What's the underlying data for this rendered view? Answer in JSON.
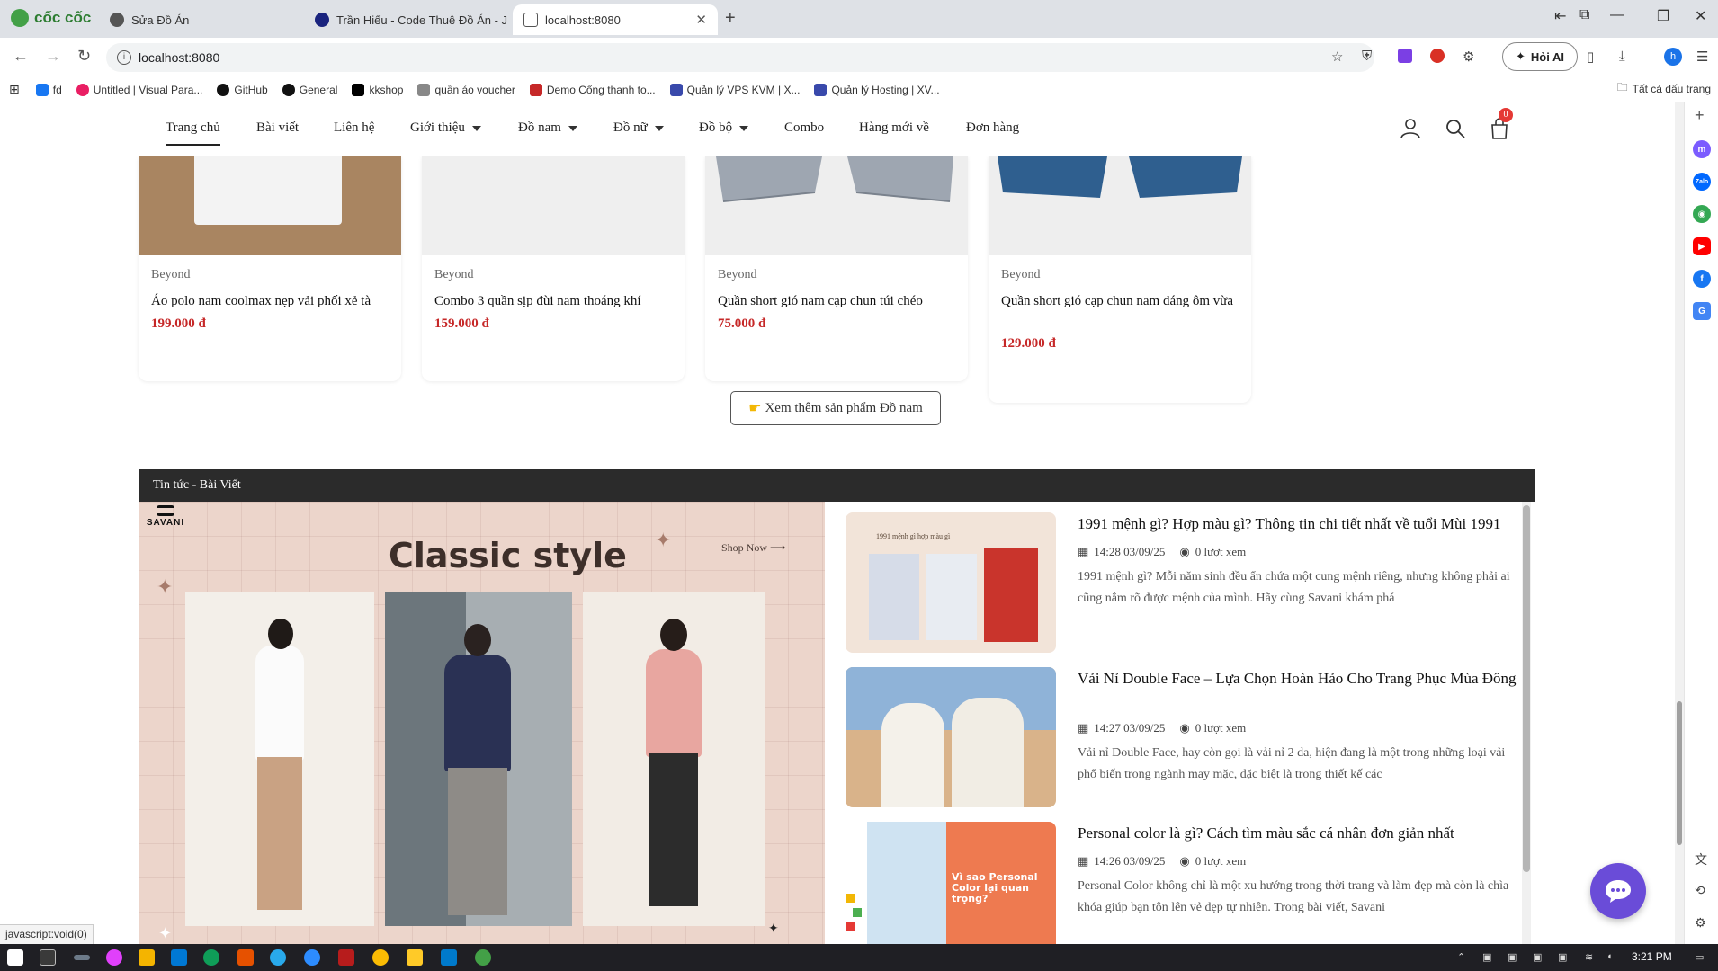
{
  "browser": {
    "brand": "cốc cốc",
    "tabs": [
      {
        "title": "Sửa Đồ Án",
        "active": false
      },
      {
        "title": "Trần Hiếu - Code Thuê Đồ Án - J",
        "active": false
      },
      {
        "title": "localhost:8080",
        "active": true
      }
    ],
    "address": "localhost:8080",
    "ai_button": "Hỏi AI",
    "profile_initial": "h",
    "bookmarks": [
      "fd",
      "Untitled | Visual Para...",
      "GitHub",
      "General",
      "kkshop",
      "quần áo voucher",
      "Demo Cổng thanh to...",
      "Quản lý VPS KVM | X...",
      "Quản lý Hosting | XV..."
    ],
    "all_bookmarks": "Tất cả dấu trang",
    "status_url": "javascript:void(0)"
  },
  "nav": {
    "items": [
      {
        "label": "Trang chủ",
        "dropdown": false,
        "active": true
      },
      {
        "label": "Bài viết",
        "dropdown": false,
        "active": false
      },
      {
        "label": "Liên hệ",
        "dropdown": false,
        "active": false
      },
      {
        "label": "Giới thiệu",
        "dropdown": true,
        "active": false
      },
      {
        "label": "Đồ nam",
        "dropdown": true,
        "active": false
      },
      {
        "label": "Đồ nữ",
        "dropdown": true,
        "active": false
      },
      {
        "label": "Đồ bộ",
        "dropdown": true,
        "active": false
      },
      {
        "label": "Combo",
        "dropdown": false,
        "active": false
      },
      {
        "label": "Hàng mới về",
        "dropdown": false,
        "active": false
      },
      {
        "label": "Đơn hàng",
        "dropdown": false,
        "active": false
      }
    ],
    "cart_count": "0",
    "icons": [
      "user-icon",
      "search-icon",
      "cart-icon"
    ]
  },
  "products": [
    {
      "brand": "Beyond",
      "name": "Áo polo nam coolmax nẹp vải phối xẻ tà",
      "price": "199.000 đ"
    },
    {
      "brand": "Beyond",
      "name": "Combo 3 quần sịp đùi nam thoáng khí",
      "price": "159.000 đ"
    },
    {
      "brand": "Beyond",
      "name": "Quần short gió nam cạp chun túi chéo",
      "price": "75.000 đ"
    },
    {
      "brand": "Beyond",
      "name": "Quần short gió cạp chun nam dáng ôm vừa",
      "price": "129.000 đ"
    }
  ],
  "see_more": "Xem thêm sản phẩm Đồ nam",
  "news": {
    "header": "Tin tức - Bài Viết",
    "banner": {
      "logo": "SAVANI",
      "title": "Classic style",
      "shop_now": "Shop Now"
    },
    "items": [
      {
        "title": "1991 mệnh gì? Hợp màu gì? Thông tin chi tiết nhất về tuổi Mùi 1991",
        "time": "14:28 03/09/25",
        "views": "0 lượt xem",
        "excerpt": "1991 mệnh gì? Mỗi năm sinh đều ẩn chứa một cung mệnh riêng, nhưng không phải ai cũng nắm rõ được mệnh của mình. Hãy cùng Savani khám phá",
        "thumb_caption": "1991 mệnh gì hợp màu gì"
      },
      {
        "title": "Vải Nỉ Double Face – Lựa Chọn Hoàn Hảo Cho Trang Phục Mùa Đông",
        "time": "14:27 03/09/25",
        "views": "0 lượt xem",
        "excerpt": "Vải nỉ Double Face, hay còn gọi là vải nỉ 2 da, hiện đang là một trong những loại vải phổ biến trong ngành may mặc, đặc biệt là trong thiết kế các",
        "thumb_caption": ""
      },
      {
        "title": "Personal color là gì? Cách tìm màu sắc cá nhân đơn giản nhất",
        "time": "14:26 03/09/25",
        "views": "0 lượt xem",
        "excerpt": "Personal Color không chỉ là một xu hướng trong thời trang và làm đẹp mà còn là chìa khóa giúp bạn tôn lên vẻ đẹp tự nhiên. Trong bài viết, Savani",
        "thumb_caption": "Vì sao Personal Color lại quan trọng?"
      }
    ]
  },
  "taskbar": {
    "time": "3:21 PM"
  },
  "colors": {
    "price": "#c62828",
    "news_header_bg": "#2b2b2b",
    "chat_button": "#6a4cd8",
    "cart_badge": "#e53935"
  }
}
